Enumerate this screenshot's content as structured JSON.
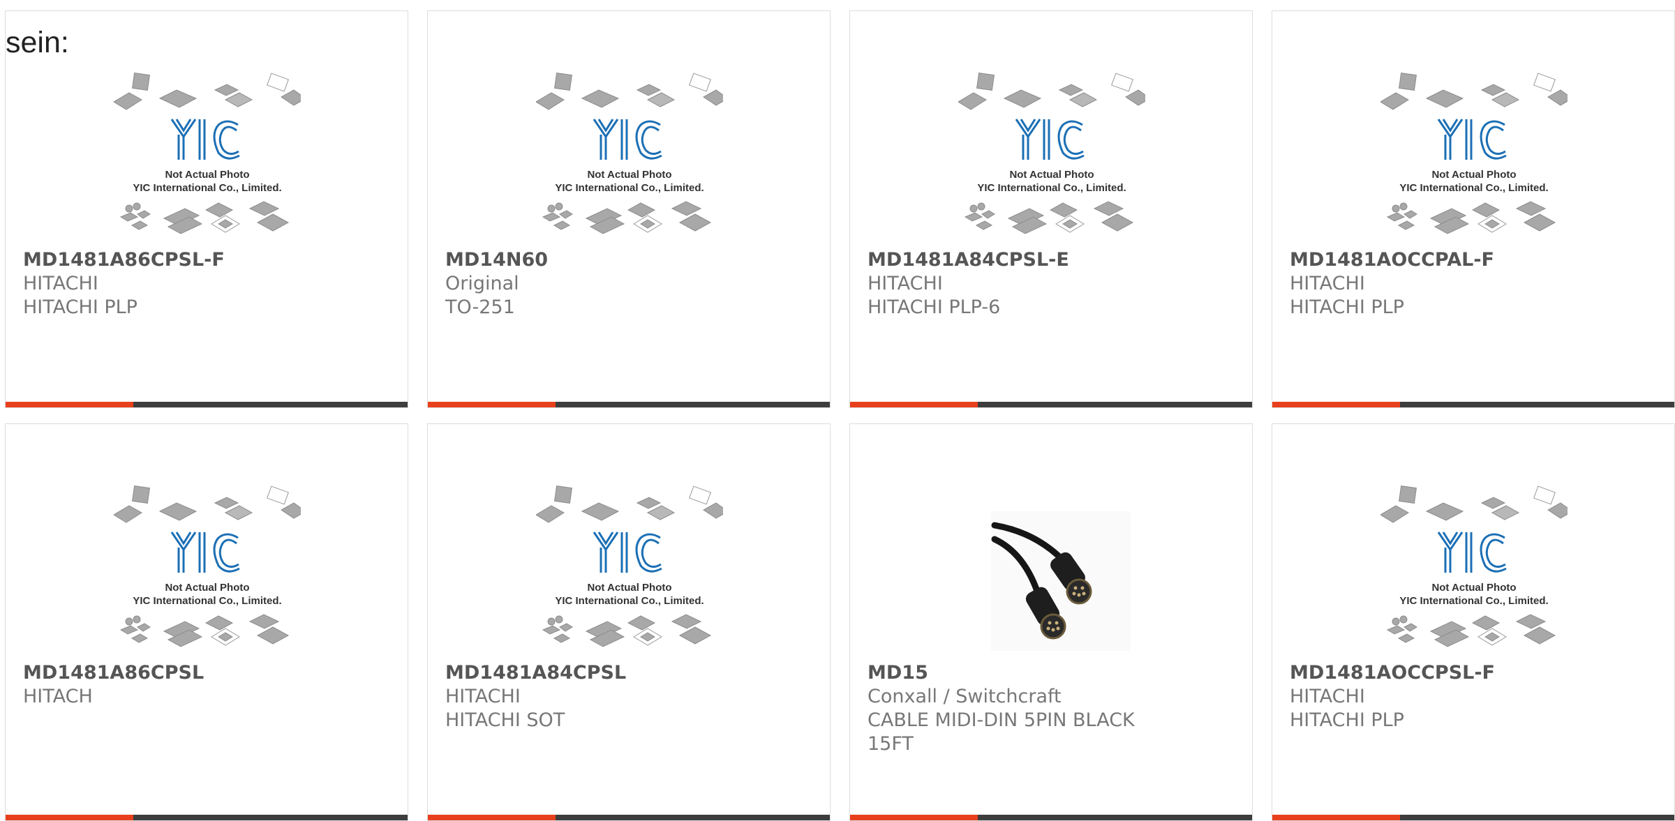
{
  "heading": "sein:",
  "placeholder": {
    "line1": "Not Actual Photo",
    "line2": "YIC International Co., Limited.",
    "logo": "YIC"
  },
  "products": [
    {
      "part": "MD1481A86CPSL-F",
      "lines": [
        "HITACHI",
        "HITACHI PLP"
      ],
      "image": "placeholder"
    },
    {
      "part": "MD14N60",
      "lines": [
        "Original",
        "TO-251"
      ],
      "image": "placeholder"
    },
    {
      "part": "MD1481A84CPSL-E",
      "lines": [
        "HITACHI",
        "HITACHI PLP-6"
      ],
      "image": "placeholder"
    },
    {
      "part": "MD1481AOCCPAL-F",
      "lines": [
        "HITACHI",
        "HITACHI PLP"
      ],
      "image": "placeholder"
    },
    {
      "part": "MD1481A86CPSL",
      "lines": [
        "HITACH"
      ],
      "image": "placeholder"
    },
    {
      "part": "MD1481A84CPSL",
      "lines": [
        "HITACHI",
        "HITACHI SOT"
      ],
      "image": "placeholder"
    },
    {
      "part": "MD15",
      "lines": [
        "Conxall / Switchcraft",
        "CABLE MIDI-DIN 5PIN BLACK",
        "15FT"
      ],
      "image": "cable"
    },
    {
      "part": "MD1481AOCCPSL-F",
      "lines": [
        "HITACHI",
        "HITACHI PLP"
      ],
      "image": "placeholder"
    }
  ],
  "colors": {
    "accent": "#e8401c",
    "bar": "#3d3d3d",
    "logo": "#1b6fb5"
  }
}
